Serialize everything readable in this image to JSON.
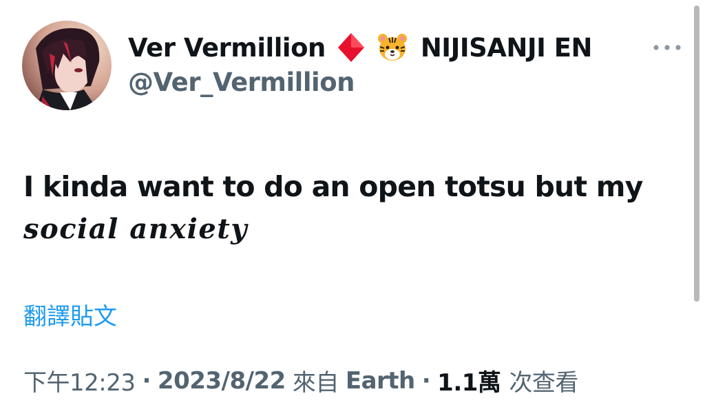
{
  "author": {
    "display_name": "Ver Vermillion",
    "badge_icons": [
      "red-diamond-icon",
      "tiger-face-icon"
    ],
    "agency": "NIJISANJI EN",
    "handle": "@Ver_Vermillion"
  },
  "tweet": {
    "text_line_1": "I kinda want to do an open totsu but my",
    "text_line_2": "social anxiety"
  },
  "translate_label": "翻譯貼文",
  "meta": {
    "time": "下午12:23",
    "separator": "·",
    "date": "2023/8/22",
    "source_prefix": "來自",
    "source": "Earth",
    "views_count": "1.1萬",
    "views_label": "次查看"
  },
  "colors": {
    "text_primary": "#0f1419",
    "text_secondary": "#536471",
    "link": "#1d9bf0",
    "diamond": "#e8112d",
    "tiger": "#f7b32b"
  },
  "more_icon": "more-horizontal-icon"
}
